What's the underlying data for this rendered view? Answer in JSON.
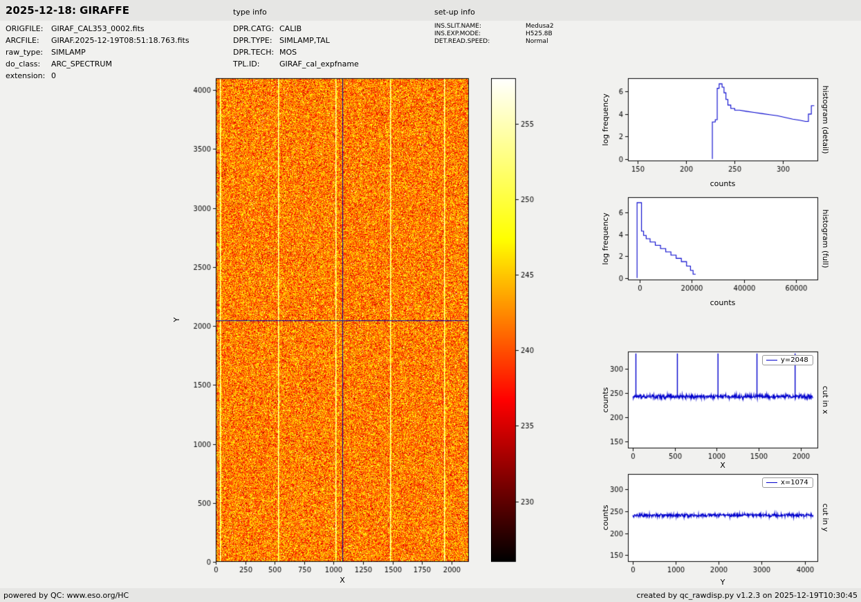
{
  "header": {
    "title": "2025-12-18: GIRAFFE",
    "type_info_label": "type info",
    "setup_info_label": "set-up info"
  },
  "file_info": {
    "rows": [
      {
        "label": "ORIGFILE:",
        "value": "GIRAF_CAL353_0002.fits"
      },
      {
        "label": "ARCFILE:",
        "value": "GIRAF.2025-12-19T08:51:18.763.fits"
      },
      {
        "label": "raw_type:",
        "value": "SIMLAMP"
      },
      {
        "label": "do_class:",
        "value": "ARC_SPECTRUM"
      },
      {
        "label": "extension:",
        "value": "0"
      }
    ]
  },
  "type_info": {
    "rows": [
      {
        "label": "DPR.CATG:",
        "value": "CALIB"
      },
      {
        "label": "DPR.TYPE:",
        "value": "SIMLAMP,TAL"
      },
      {
        "label": "DPR.TECH:",
        "value": "MOS"
      },
      {
        "label": "TPL.ID:",
        "value": "GIRAF_cal_expfname"
      }
    ]
  },
  "setup_info": {
    "rows": [
      {
        "label": "INS.SLIT.NAME:",
        "value": "Medusa2"
      },
      {
        "label": "INS.EXP.MODE:",
        "value": "H525.8B"
      },
      {
        "label": "DET.READ.SPEED:",
        "value": "Normal"
      }
    ]
  },
  "footer": {
    "left": "powered by QC: www.eso.org/HC",
    "right": "created by qc_rawdisp.py v1.2.3 on 2025-12-19T10:30:45"
  },
  "chart_data": [
    {
      "id": "raw_image",
      "type": "heatmap",
      "xlabel": "X",
      "ylabel": "Y",
      "xlim": [
        0,
        2148
      ],
      "ylim": [
        0,
        4100
      ],
      "xticks": [
        0,
        250,
        500,
        750,
        1000,
        1250,
        1500,
        1750,
        2000
      ],
      "yticks": [
        0,
        500,
        1000,
        1500,
        2000,
        2500,
        3000,
        3500,
        4000
      ],
      "background_level": 242,
      "noise_sigma": 4,
      "bright_lines_x": [
        35,
        530,
        1015,
        1480,
        1935
      ],
      "crosshair": {
        "x": 1074,
        "y": 2048
      },
      "colormap": "hot",
      "colorbar": {
        "vmin": 226,
        "vmax": 258,
        "ticks": [
          230,
          235,
          240,
          245,
          250,
          255
        ]
      }
    },
    {
      "id": "hist_detail",
      "type": "line",
      "side_label": "histogram (detail)",
      "xlabel": "counts",
      "ylabel": "log frequency",
      "xlim": [
        140,
        336
      ],
      "ylim": [
        -0.2,
        7.2
      ],
      "xticks": [
        150,
        200,
        250,
        300
      ],
      "yticks": [
        0,
        2,
        4,
        6
      ],
      "x": [
        227,
        227,
        230,
        230,
        232,
        232,
        234,
        234,
        237,
        237,
        239,
        239,
        241,
        241,
        243,
        243,
        246,
        246,
        250,
        250,
        255,
        262,
        270,
        278,
        286,
        294,
        302,
        310,
        317,
        323,
        326,
        326,
        329,
        329,
        332
      ],
      "y": [
        0,
        3.3,
        3.3,
        3.5,
        3.5,
        6.3,
        6.3,
        6.7,
        6.7,
        6.4,
        6.4,
        5.9,
        5.9,
        5.3,
        5.3,
        4.8,
        4.8,
        4.5,
        4.5,
        4.35,
        4.35,
        4.25,
        4.15,
        4.05,
        3.95,
        3.85,
        3.7,
        3.55,
        3.45,
        3.35,
        3.35,
        4.0,
        4.0,
        4.75,
        4.75
      ]
    },
    {
      "id": "hist_full",
      "type": "line",
      "side_label": "histogram (full)",
      "xlabel": "counts",
      "ylabel": "log frequency",
      "xlim": [
        -4500,
        68500
      ],
      "ylim": [
        -0.2,
        7.4
      ],
      "xticks": [
        0,
        20000,
        40000,
        60000
      ],
      "yticks": [
        0,
        2,
        4,
        6
      ],
      "x": [
        -1000,
        -1000,
        700,
        700,
        1500,
        1500,
        2500,
        2500,
        4000,
        4000,
        6000,
        6000,
        8000,
        8000,
        10000,
        10000,
        12000,
        12000,
        14000,
        14000,
        16000,
        16000,
        18000,
        18000,
        19500,
        19500,
        20500,
        20500,
        21500
      ],
      "y": [
        0,
        6.9,
        6.9,
        4.3,
        4.3,
        3.9,
        3.9,
        3.6,
        3.6,
        3.3,
        3.3,
        3.0,
        3.0,
        2.7,
        2.7,
        2.4,
        2.4,
        2.1,
        2.1,
        1.8,
        1.8,
        1.5,
        1.5,
        1.1,
        1.1,
        0.7,
        0.7,
        0.35,
        0.35
      ]
    },
    {
      "id": "cut_x",
      "type": "line",
      "side_label": "cut in x",
      "legend": "y=2048",
      "xlabel": "X",
      "ylabel": "counts",
      "xlim": [
        -60,
        2210
      ],
      "ylim": [
        135,
        335
      ],
      "xticks": [
        0,
        500,
        1000,
        1500,
        2000
      ],
      "yticks": [
        150,
        200,
        250,
        300
      ],
      "xrange": [
        0,
        2148
      ],
      "baseline": 242,
      "noise_sigma": 2.3,
      "spikes_x": [
        35,
        530,
        1015,
        1480,
        1935
      ],
      "spike_top": 331
    },
    {
      "id": "cut_y",
      "type": "line",
      "side_label": "cut in y",
      "legend": "x=1074",
      "xlabel": "Y",
      "ylabel": "counts",
      "xlim": [
        -110,
        4310
      ],
      "ylim": [
        135,
        335
      ],
      "xticks": [
        0,
        1000,
        2000,
        3000,
        4000
      ],
      "yticks": [
        150,
        200,
        250,
        300
      ],
      "xrange": [
        0,
        4200
      ],
      "baseline": 241,
      "noise_sigma": 2.2,
      "spikes_x": [],
      "spike_top": null
    }
  ]
}
